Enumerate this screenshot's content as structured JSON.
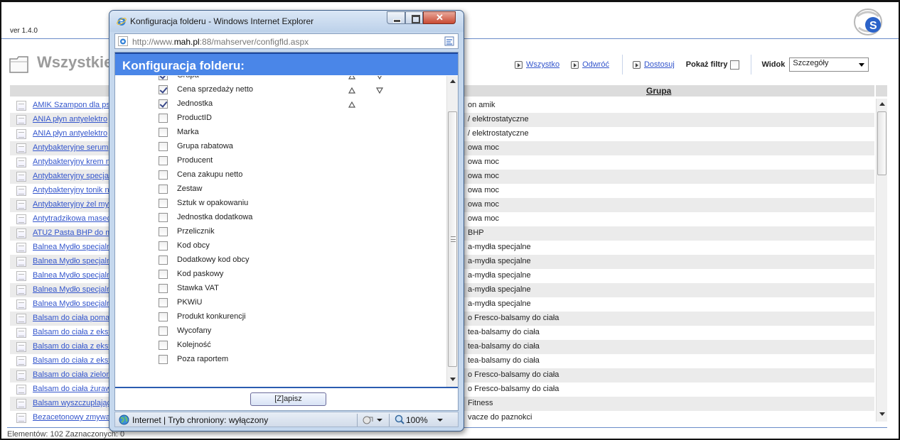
{
  "app": {
    "version": "ver 1.4.0",
    "page_title": "Wszystkie",
    "toolbar": {
      "all_label": "Wszystko",
      "invert_label": "Odwróć",
      "customize_label": "Dostosuj",
      "show_filters_label": "Pokaż filtry",
      "view_label": "Widok",
      "view_value": "Szczegóły"
    },
    "grid": {
      "column_group": "Grupa",
      "rows": [
        {
          "name": "AMIK Szampon dla pso",
          "group": "on amik"
        },
        {
          "name": "ANIA płyn antyelektro",
          "group": "/ elektrostatyczne"
        },
        {
          "name": "ANIA płyn antyelektro",
          "group": "/ elektrostatyczne"
        },
        {
          "name": "Antybakteryjne serum",
          "group": "owa moc"
        },
        {
          "name": "Antybakteryjny krem n",
          "group": "owa moc"
        },
        {
          "name": "Antybakteryjny specja",
          "group": "owa moc"
        },
        {
          "name": "Antybakteryjny tonik n",
          "group": "owa moc"
        },
        {
          "name": "Antybakteryjny żel my",
          "group": "owa moc"
        },
        {
          "name": "Antytradzikowa masec",
          "group": "owa moc"
        },
        {
          "name": "ATU2 Pasta BHP do my",
          "group": "BHP"
        },
        {
          "name": "Balnea Mydło specjaln",
          "group": "a-mydła specjalne"
        },
        {
          "name": "Balnea Mydło specjaln",
          "group": "a-mydła specjalne"
        },
        {
          "name": "Balnea Mydło specjaln",
          "group": "a-mydła specjalne"
        },
        {
          "name": "Balnea Mydło specjaln",
          "group": "a-mydła specjalne"
        },
        {
          "name": "Balnea Mydło specjaln",
          "group": "a-mydła specjalne"
        },
        {
          "name": "Balsam do ciała pomar",
          "group": "o Fresco-balsamy do ciała"
        },
        {
          "name": "Balsam do ciała z ekstr",
          "group": "tea-balsamy do ciała"
        },
        {
          "name": "Balsam do ciała z ekstr",
          "group": "tea-balsamy do ciała"
        },
        {
          "name": "Balsam do ciała z ekstr",
          "group": "tea-balsamy do ciała"
        },
        {
          "name": "Balsam do ciała zielone",
          "group": "o Fresco-balsamy do ciała"
        },
        {
          "name": "Balsam do ciała żurawi",
          "group": "o Fresco-balsamy do ciała"
        },
        {
          "name": "Balsam wyszczuplający",
          "group": "Fitness"
        },
        {
          "name": "Bezacetonowy zmywac",
          "group": "vacze do paznokci"
        }
      ]
    },
    "status": "Elementów: 102  Zaznaczonych: 0"
  },
  "popup": {
    "window_title": "Konfiguracja folderu - Windows Internet Explorer",
    "address": {
      "prefix": "http://www.",
      "domain": "mah.pl",
      "suffix": ":88/mahserver/configfld.aspx"
    },
    "dialog_title": "Konfiguracja folderu:",
    "fields": [
      {
        "label": "Grupa",
        "checked": true,
        "up": true,
        "down": true
      },
      {
        "label": "Cena sprzedaży netto",
        "checked": true,
        "up": true,
        "down": true
      },
      {
        "label": "Jednostka",
        "checked": true,
        "up": true,
        "down": false
      },
      {
        "label": "ProductID",
        "checked": false,
        "up": false,
        "down": false
      },
      {
        "label": "Marka",
        "checked": false,
        "up": false,
        "down": false
      },
      {
        "label": "Grupa rabatowa",
        "checked": false,
        "up": false,
        "down": false
      },
      {
        "label": "Producent",
        "checked": false,
        "up": false,
        "down": false
      },
      {
        "label": "Cena zakupu netto",
        "checked": false,
        "up": false,
        "down": false
      },
      {
        "label": "Zestaw",
        "checked": false,
        "up": false,
        "down": false
      },
      {
        "label": "Sztuk w opakowaniu",
        "checked": false,
        "up": false,
        "down": false
      },
      {
        "label": "Jednostka dodatkowa",
        "checked": false,
        "up": false,
        "down": false
      },
      {
        "label": "Przelicznik",
        "checked": false,
        "up": false,
        "down": false
      },
      {
        "label": "Kod obcy",
        "checked": false,
        "up": false,
        "down": false
      },
      {
        "label": "Dodatkowy kod obcy",
        "checked": false,
        "up": false,
        "down": false
      },
      {
        "label": "Kod paskowy",
        "checked": false,
        "up": false,
        "down": false
      },
      {
        "label": "Stawka VAT",
        "checked": false,
        "up": false,
        "down": false
      },
      {
        "label": "PKWiU",
        "checked": false,
        "up": false,
        "down": false
      },
      {
        "label": "Produkt konkurencji",
        "checked": false,
        "up": false,
        "down": false
      },
      {
        "label": "Wycofany",
        "checked": false,
        "up": false,
        "down": false
      },
      {
        "label": "Kolejność",
        "checked": false,
        "up": false,
        "down": false
      },
      {
        "label": "Poza raportem",
        "checked": false,
        "up": false,
        "down": false
      }
    ],
    "save_label": "[Z]apisz",
    "status_text": "Internet | Tryb chroniony: wyłączony",
    "zoom": "100%"
  }
}
